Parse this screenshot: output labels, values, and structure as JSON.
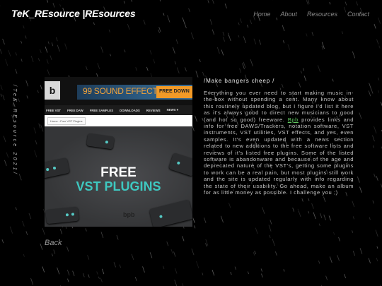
{
  "site": {
    "title": "TeK_REsource |REsources"
  },
  "nav": {
    "items": [
      "Home",
      "About",
      "Resources",
      "Contact"
    ]
  },
  "sidebar": {
    "vertical_text": "/TeK_REsource 2021/"
  },
  "article": {
    "heading": "/Make bangers cheep /",
    "body_before_link": "Everything you ever need to start making music in-the-box without spending a cent. Many know about this routinely updated blog, but I figure I'd list it here as it's always good to direct new musicians to good (and hot so good) freeware.",
    "link_text": "Bpb",
    "body_after_link": "provides links and info for free DAWS/Trackers, notation software, VST instruments, VST utilities, VST effects, and yes, even samples. It's even updated with a news section related to new additions to the free software lists and reviews of it's listed free plugins. Some of the listed software is abandonware and because of the age and deprecated nature of the VST's, getting some plugins to work can be a real pain, but most plugins still work and the site is updated regularly with info regarding the state of their usability. Go ahead, make an album for as little money as possible. I challenge you ;)",
    "back_label": "Back"
  },
  "thumbnail": {
    "logo": "b",
    "ad_text": "99 SOUND EFFECTS",
    "ad_button": "FREE DOWN",
    "menu": [
      "FREE VST",
      "FREE DAW",
      "FREE SAMPLES",
      "DOWNLOADS",
      "REVIEWS",
      "NEWS ▾"
    ],
    "breadcrumb": "Home  ›  Free VST Plugins",
    "hero_line1": "FREE",
    "hero_line2": "VST PLUGINS",
    "hero_logo": "bpb",
    "colors": {
      "accent": "#3ec8c0",
      "ad_orange": "#f29a27"
    }
  },
  "colors": {
    "background": "#000000",
    "link": "#5fc65f"
  }
}
